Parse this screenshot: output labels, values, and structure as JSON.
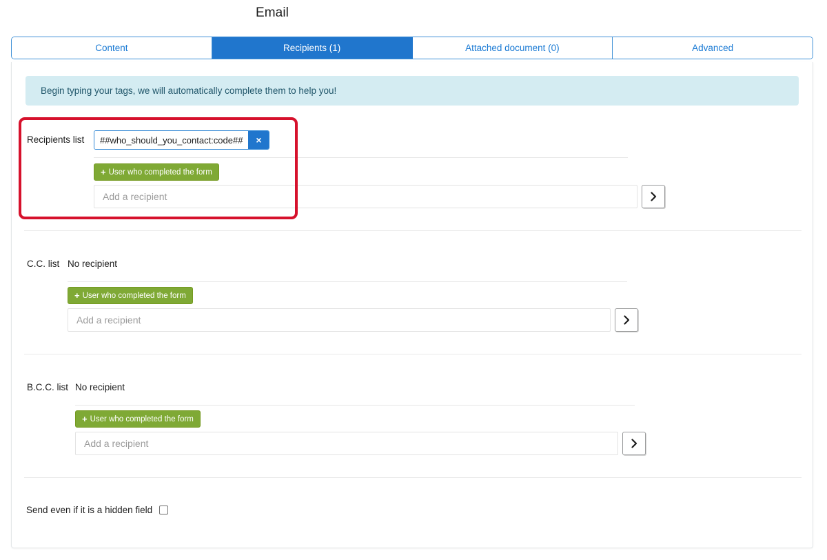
{
  "header": {
    "title": "Email"
  },
  "tabs": [
    {
      "label": "Content",
      "active": false
    },
    {
      "label": "Recipients (1)",
      "active": true
    },
    {
      "label": "Attached document (0)",
      "active": false
    },
    {
      "label": "Advanced",
      "active": false
    }
  ],
  "info_banner": {
    "text": "Begin typing your tags, we will automatically complete them to help you!"
  },
  "recipients": {
    "label": "Recipients list",
    "chip": {
      "text": "##who_should_you_contact:code##",
      "remove_icon": "×"
    },
    "add_button_label": "User who completed the form",
    "input_placeholder": "Add a recipient",
    "input_value": "",
    "expand_icon": "chevron-right-icon"
  },
  "cc": {
    "label": "C.C. list",
    "empty_text": "No recipient",
    "add_button_label": "User who completed the form",
    "input_placeholder": "Add a recipient",
    "input_value": "",
    "expand_icon": "chevron-right-icon"
  },
  "bcc": {
    "label": "B.C.C. list",
    "empty_text": "No recipient",
    "add_button_label": "User who completed the form",
    "input_placeholder": "Add a recipient",
    "input_value": "",
    "expand_icon": "chevron-right-icon"
  },
  "hidden_field": {
    "label": "Send even if it is a hidden field",
    "checked": false
  },
  "colors": {
    "tab_active_bg": "#2076cd",
    "tab_link": "#1a7ad4",
    "banner_bg": "#d4ecf2",
    "green_button": "#7fa935",
    "highlight_outline": "#d6112c"
  },
  "plus_glyph": "+"
}
